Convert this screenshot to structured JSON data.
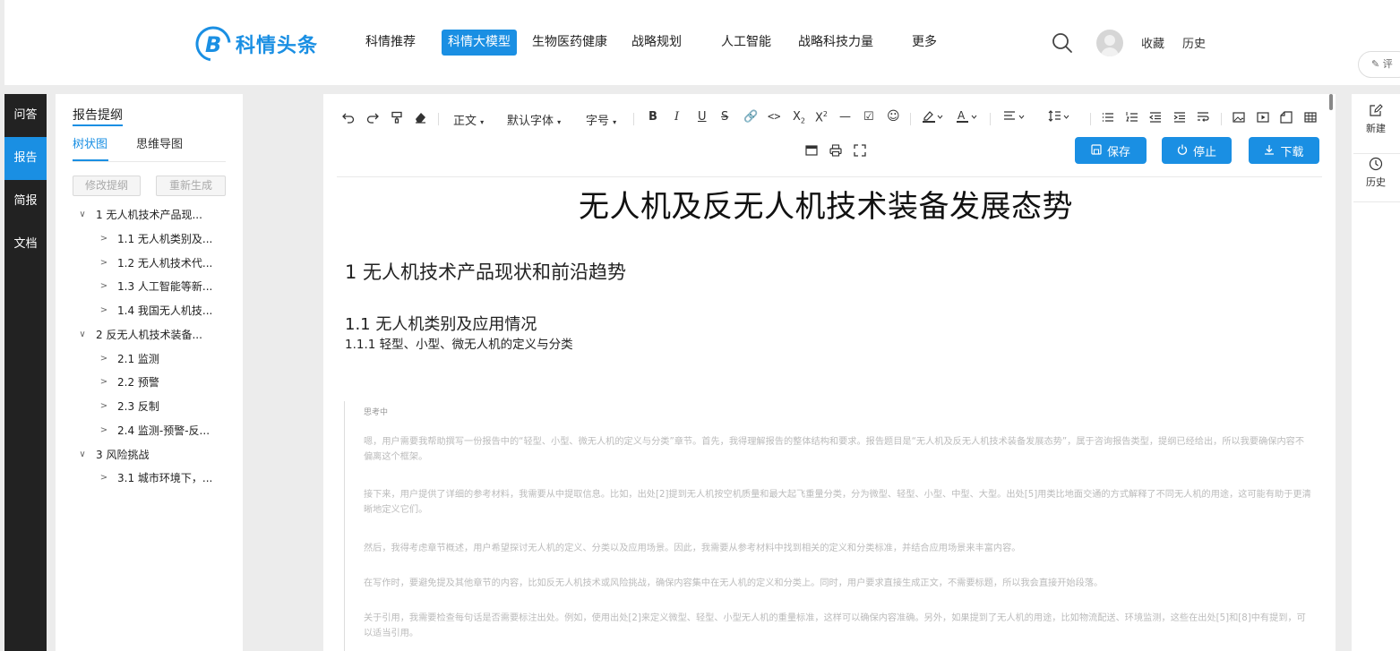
{
  "brand": {
    "name": "科情头条",
    "accent": "#1a8fe3"
  },
  "nav": {
    "items": [
      "科情推荐",
      "科情大模型",
      "生物医药健康",
      "战略规划",
      "人工智能",
      "战略科技力量",
      "更多"
    ],
    "active": "科情大模型",
    "favorites": "收藏",
    "history": "历史",
    "eval": "评"
  },
  "sidebar": {
    "items": [
      "问答",
      "报告",
      "简报",
      "文档"
    ],
    "active": "报告"
  },
  "outline": {
    "title": "报告提纲",
    "tabs": [
      "树状图",
      "思维导图"
    ],
    "buttons": [
      "修改提纲",
      "重新生成"
    ],
    "tree": [
      {
        "level": 1,
        "label": "1 无人机技术产品现...",
        "arrow": "expanded"
      },
      {
        "level": 2,
        "label": "1.1 无人机类别及...",
        "arrow": "collapsed"
      },
      {
        "level": 2,
        "label": "1.2 无人机技术代...",
        "arrow": "collapsed"
      },
      {
        "level": 2,
        "label": "1.3 人工智能等新...",
        "arrow": "collapsed"
      },
      {
        "level": 2,
        "label": "1.4 我国无人机技...",
        "arrow": "collapsed"
      },
      {
        "level": 1,
        "label": "2 反无人机技术装备...",
        "arrow": "expanded"
      },
      {
        "level": 2,
        "label": "2.1 监测",
        "arrow": "collapsed"
      },
      {
        "level": 2,
        "label": "2.2 预警",
        "arrow": "collapsed"
      },
      {
        "level": 2,
        "label": "2.3 反制",
        "arrow": "collapsed"
      },
      {
        "level": 2,
        "label": "2.4 监测-预警-反...",
        "arrow": "collapsed"
      },
      {
        "level": 1,
        "label": "3 风险挑战",
        "arrow": "expanded"
      },
      {
        "level": 2,
        "label": "3.1 城市环境下，...",
        "arrow": "collapsed"
      }
    ]
  },
  "toolbar": {
    "paragraph": "正文",
    "font": "默认字体",
    "size": "字号",
    "save": "保存",
    "stop": "停止",
    "download": "下载"
  },
  "document": {
    "title": "无人机及反无人机技术装备发展态势",
    "h1": "1 无人机技术产品现状和前沿趋势",
    "h2": "1.1 无人机类别及应用情况",
    "h3": "1.1.1 轻型、小型、微无人机的定义与分类",
    "thinking_label": "思考中",
    "thinking": [
      "嗯，用户需要我帮助撰写一份报告中的“轻型、小型、微无人机的定义与分类”章节。首先，我得理解报告的整体结构和要求。报告题目是“无人机及反无人机技术装备发展态势”，属于咨询报告类型，提纲已经给出，所以我要确保内容不偏离这个框架。",
      "接下来，用户提供了详细的参考材料，我需要从中提取信息。比如，出处[2]提到无人机按空机质量和最大起飞重量分类，分为微型、轻型、小型、中型、大型。出处[5]用类比地面交通的方式解释了不同无人机的用途，这可能有助于更清晰地定义它们。",
      "然后，我得考虑章节概述，用户希望探讨无人机的定义、分类以及应用场景。因此，我需要从参考材料中找到相关的定义和分类标准，并结合应用场景来丰富内容。",
      "在写作时，要避免提及其他章节的内容，比如反无人机技术或风险挑战，确保内容集中在无人机的定义和分类上。同时，用户要求直接生成正文，不需要标题，所以我会直接开始段落。",
      "关于引用，我需要检查每句话是否需要标注出处。例如，使用出处[2]来定义微型、轻型、小型无人机的重量标准，这样可以确保内容准确。另外，如果提到了无人机的用途，比如物流配送、环境监测，这些在出处[5]和[8]中有提到，可以适当引用。"
    ]
  },
  "rightbar": {
    "new": "新建",
    "history": "历史"
  }
}
